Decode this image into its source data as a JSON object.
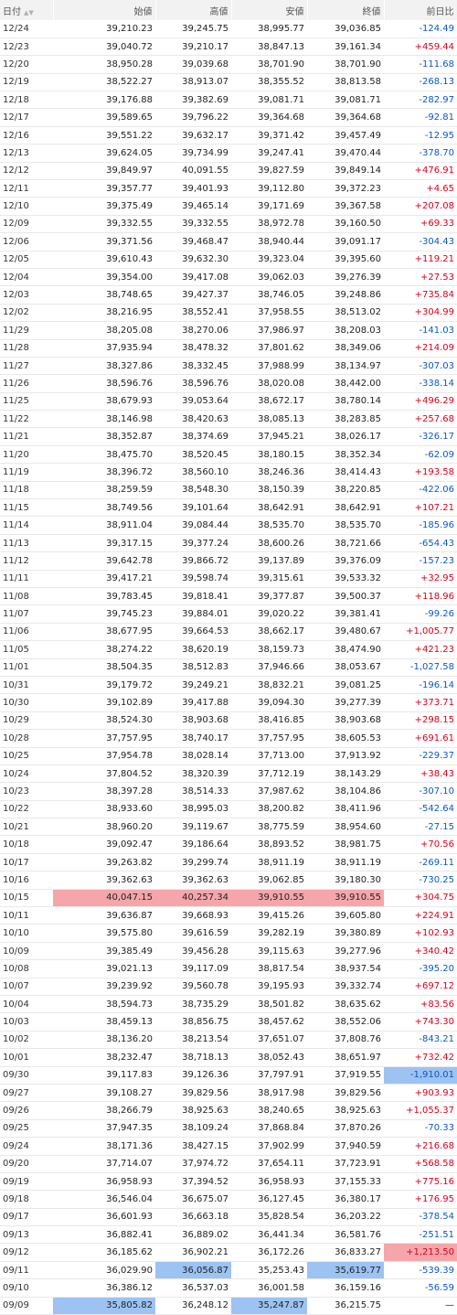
{
  "columns": {
    "date": "日付",
    "open": "始値",
    "high": "高値",
    "low": "安値",
    "close": "終値",
    "change": "前日比"
  },
  "sort_arrows": "▲▼",
  "colors": {
    "positive": "#d8001b",
    "negative": "#0a58c2",
    "high_highlight": "#f5a6ab",
    "low_highlight": "#9cc3f2"
  },
  "rows": [
    {
      "date": "12/24",
      "open": "39,210.23",
      "high": "39,245.75",
      "low": "38,995.77",
      "close": "39,036.85",
      "change": "-124.49"
    },
    {
      "date": "12/23",
      "open": "39,040.72",
      "high": "39,210.17",
      "low": "38,847.13",
      "close": "39,161.34",
      "change": "+459.44"
    },
    {
      "date": "12/20",
      "open": "38,950.28",
      "high": "39,039.68",
      "low": "38,701.90",
      "close": "38,701.90",
      "change": "-111.68"
    },
    {
      "date": "12/19",
      "open": "38,522.27",
      "high": "38,913.07",
      "low": "38,355.52",
      "close": "38,813.58",
      "change": "-268.13"
    },
    {
      "date": "12/18",
      "open": "39,176.88",
      "high": "39,382.69",
      "low": "39,081.71",
      "close": "39,081.71",
      "change": "-282.97"
    },
    {
      "date": "12/17",
      "open": "39,589.65",
      "high": "39,796.22",
      "low": "39,364.68",
      "close": "39,364.68",
      "change": "-92.81"
    },
    {
      "date": "12/16",
      "open": "39,551.22",
      "high": "39,632.17",
      "low": "39,371.42",
      "close": "39,457.49",
      "change": "-12.95"
    },
    {
      "date": "12/13",
      "open": "39,624.05",
      "high": "39,734.99",
      "low": "39,247.41",
      "close": "39,470.44",
      "change": "-378.70"
    },
    {
      "date": "12/12",
      "open": "39,849.97",
      "high": "40,091.55",
      "low": "39,827.59",
      "close": "39,849.14",
      "change": "+476.91"
    },
    {
      "date": "12/11",
      "open": "39,357.77",
      "high": "39,401.93",
      "low": "39,112.80",
      "close": "39,372.23",
      "change": "+4.65"
    },
    {
      "date": "12/10",
      "open": "39,375.49",
      "high": "39,465.14",
      "low": "39,171.69",
      "close": "39,367.58",
      "change": "+207.08"
    },
    {
      "date": "12/09",
      "open": "39,332.55",
      "high": "39,332.55",
      "low": "38,972.78",
      "close": "39,160.50",
      "change": "+69.33"
    },
    {
      "date": "12/06",
      "open": "39,371.56",
      "high": "39,468.47",
      "low": "38,940.44",
      "close": "39,091.17",
      "change": "-304.43"
    },
    {
      "date": "12/05",
      "open": "39,610.43",
      "high": "39,632.30",
      "low": "39,323.04",
      "close": "39,395.60",
      "change": "+119.21"
    },
    {
      "date": "12/04",
      "open": "39,354.00",
      "high": "39,417.08",
      "low": "39,062.03",
      "close": "39,276.39",
      "change": "+27.53"
    },
    {
      "date": "12/03",
      "open": "38,748.65",
      "high": "39,427.37",
      "low": "38,746.05",
      "close": "39,248.86",
      "change": "+735.84"
    },
    {
      "date": "12/02",
      "open": "38,216.95",
      "high": "38,552.41",
      "low": "37,958.55",
      "close": "38,513.02",
      "change": "+304.99"
    },
    {
      "date": "11/29",
      "open": "38,205.08",
      "high": "38,270.06",
      "low": "37,986.97",
      "close": "38,208.03",
      "change": "-141.03"
    },
    {
      "date": "11/28",
      "open": "37,935.94",
      "high": "38,478.32",
      "low": "37,801.62",
      "close": "38,349.06",
      "change": "+214.09"
    },
    {
      "date": "11/27",
      "open": "38,327.86",
      "high": "38,332.45",
      "low": "37,988.99",
      "close": "38,134.97",
      "change": "-307.03"
    },
    {
      "date": "11/26",
      "open": "38,596.76",
      "high": "38,596.76",
      "low": "38,020.08",
      "close": "38,442.00",
      "change": "-338.14"
    },
    {
      "date": "11/25",
      "open": "38,679.93",
      "high": "39,053.64",
      "low": "38,672.17",
      "close": "38,780.14",
      "change": "+496.29"
    },
    {
      "date": "11/22",
      "open": "38,146.98",
      "high": "38,420.63",
      "low": "38,085.13",
      "close": "38,283.85",
      "change": "+257.68"
    },
    {
      "date": "11/21",
      "open": "38,352.87",
      "high": "38,374.69",
      "low": "37,945.21",
      "close": "38,026.17",
      "change": "-326.17"
    },
    {
      "date": "11/20",
      "open": "38,475.70",
      "high": "38,520.45",
      "low": "38,180.15",
      "close": "38,352.34",
      "change": "-62.09"
    },
    {
      "date": "11/19",
      "open": "38,396.72",
      "high": "38,560.10",
      "low": "38,246.36",
      "close": "38,414.43",
      "change": "+193.58"
    },
    {
      "date": "11/18",
      "open": "38,259.59",
      "high": "38,548.30",
      "low": "38,150.39",
      "close": "38,220.85",
      "change": "-422.06"
    },
    {
      "date": "11/15",
      "open": "38,749.56",
      "high": "39,101.64",
      "low": "38,642.91",
      "close": "38,642.91",
      "change": "+107.21"
    },
    {
      "date": "11/14",
      "open": "38,911.04",
      "high": "39,084.44",
      "low": "38,535.70",
      "close": "38,535.70",
      "change": "-185.96"
    },
    {
      "date": "11/13",
      "open": "39,317.15",
      "high": "39,377.24",
      "low": "38,600.26",
      "close": "38,721.66",
      "change": "-654.43"
    },
    {
      "date": "11/12",
      "open": "39,642.78",
      "high": "39,866.72",
      "low": "39,137.89",
      "close": "39,376.09",
      "change": "-157.23"
    },
    {
      "date": "11/11",
      "open": "39,417.21",
      "high": "39,598.74",
      "low": "39,315.61",
      "close": "39,533.32",
      "change": "+32.95"
    },
    {
      "date": "11/08",
      "open": "39,783.45",
      "high": "39,818.41",
      "low": "39,377.87",
      "close": "39,500.37",
      "change": "+118.96"
    },
    {
      "date": "11/07",
      "open": "39,745.23",
      "high": "39,884.01",
      "low": "39,020.22",
      "close": "39,381.41",
      "change": "-99.26"
    },
    {
      "date": "11/06",
      "open": "38,677.95",
      "high": "39,664.53",
      "low": "38,662.17",
      "close": "39,480.67",
      "change": "+1,005.77"
    },
    {
      "date": "11/05",
      "open": "38,274.22",
      "high": "38,620.19",
      "low": "38,159.73",
      "close": "38,474.90",
      "change": "+421.23"
    },
    {
      "date": "11/01",
      "open": "38,504.35",
      "high": "38,512.83",
      "low": "37,946.66",
      "close": "38,053.67",
      "change": "-1,027.58"
    },
    {
      "date": "10/31",
      "open": "39,179.72",
      "high": "39,249.21",
      "low": "38,832.21",
      "close": "39,081.25",
      "change": "-196.14"
    },
    {
      "date": "10/30",
      "open": "39,102.89",
      "high": "39,417.88",
      "low": "39,094.30",
      "close": "39,277.39",
      "change": "+373.71"
    },
    {
      "date": "10/29",
      "open": "38,524.30",
      "high": "38,903.68",
      "low": "38,416.85",
      "close": "38,903.68",
      "change": "+298.15"
    },
    {
      "date": "10/28",
      "open": "37,757.95",
      "high": "38,740.17",
      "low": "37,757.95",
      "close": "38,605.53",
      "change": "+691.61"
    },
    {
      "date": "10/25",
      "open": "37,954.78",
      "high": "38,028.14",
      "low": "37,713.00",
      "close": "37,913.92",
      "change": "-229.37"
    },
    {
      "date": "10/24",
      "open": "37,804.52",
      "high": "38,320.39",
      "low": "37,712.19",
      "close": "38,143.29",
      "change": "+38.43"
    },
    {
      "date": "10/23",
      "open": "38,397.28",
      "high": "38,514.33",
      "low": "37,987.62",
      "close": "38,104.86",
      "change": "-307.10"
    },
    {
      "date": "10/22",
      "open": "38,933.60",
      "high": "38,995.03",
      "low": "38,200.82",
      "close": "38,411.96",
      "change": "-542.64"
    },
    {
      "date": "10/21",
      "open": "38,960.20",
      "high": "39,119.67",
      "low": "38,775.59",
      "close": "38,954.60",
      "change": "-27.15"
    },
    {
      "date": "10/18",
      "open": "39,092.47",
      "high": "39,186.64",
      "low": "38,893.52",
      "close": "38,981.75",
      "change": "+70.56"
    },
    {
      "date": "10/17",
      "open": "39,263.82",
      "high": "39,299.74",
      "low": "38,911.19",
      "close": "38,911.19",
      "change": "-269.11"
    },
    {
      "date": "10/16",
      "open": "39,362.63",
      "high": "39,362.63",
      "low": "39,062.85",
      "close": "39,180.30",
      "change": "-730.25"
    },
    {
      "date": "10/15",
      "open": "40,047.15",
      "high": "40,257.34",
      "low": "39,910.55",
      "close": "39,910.55",
      "change": "+304.75",
      "highlight": "red"
    },
    {
      "date": "10/11",
      "open": "39,636.87",
      "high": "39,668.93",
      "low": "39,415.26",
      "close": "39,605.80",
      "change": "+224.91"
    },
    {
      "date": "10/10",
      "open": "39,575.80",
      "high": "39,616.59",
      "low": "39,282.19",
      "close": "39,380.89",
      "change": "+102.93"
    },
    {
      "date": "10/09",
      "open": "39,385.49",
      "high": "39,456.28",
      "low": "39,115.63",
      "close": "39,277.96",
      "change": "+340.42"
    },
    {
      "date": "10/08",
      "open": "39,021.13",
      "high": "39,117.09",
      "low": "38,817.54",
      "close": "38,937.54",
      "change": "-395.20"
    },
    {
      "date": "10/07",
      "open": "39,239.92",
      "high": "39,560.78",
      "low": "39,195.93",
      "close": "39,332.74",
      "change": "+697.12"
    },
    {
      "date": "10/04",
      "open": "38,594.73",
      "high": "38,735.29",
      "low": "38,501.82",
      "close": "38,635.62",
      "change": "+83.56"
    },
    {
      "date": "10/03",
      "open": "38,459.13",
      "high": "38,856.75",
      "low": "38,457.62",
      "close": "38,552.06",
      "change": "+743.30"
    },
    {
      "date": "10/02",
      "open": "38,136.20",
      "high": "38,213.54",
      "low": "37,651.07",
      "close": "37,808.76",
      "change": "-843.21"
    },
    {
      "date": "10/01",
      "open": "38,232.47",
      "high": "38,718.13",
      "low": "38,052.43",
      "close": "38,651.97",
      "change": "+732.42"
    },
    {
      "date": "09/30",
      "open": "39,117.83",
      "high": "39,126.36",
      "low": "37,797.91",
      "close": "37,919.55",
      "change": "-1,910.01",
      "change_highlight": "blue"
    },
    {
      "date": "09/27",
      "open": "39,108.27",
      "high": "39,829.56",
      "low": "38,917.98",
      "close": "39,829.56",
      "change": "+903.93"
    },
    {
      "date": "09/26",
      "open": "38,266.79",
      "high": "38,925.63",
      "low": "38,240.65",
      "close": "38,925.63",
      "change": "+1,055.37"
    },
    {
      "date": "09/25",
      "open": "37,947.35",
      "high": "38,109.24",
      "low": "37,868.84",
      "close": "37,870.26",
      "change": "-70.33"
    },
    {
      "date": "09/24",
      "open": "38,171.36",
      "high": "38,427.15",
      "low": "37,902.99",
      "close": "37,940.59",
      "change": "+216.68"
    },
    {
      "date": "09/20",
      "open": "37,714.07",
      "high": "37,974.72",
      "low": "37,654.11",
      "close": "37,723.91",
      "change": "+568.58"
    },
    {
      "date": "09/19",
      "open": "36,958.93",
      "high": "37,394.52",
      "low": "36,958.93",
      "close": "37,155.33",
      "change": "+775.16"
    },
    {
      "date": "09/18",
      "open": "36,546.04",
      "high": "36,675.07",
      "low": "36,127.45",
      "close": "36,380.17",
      "change": "+176.95"
    },
    {
      "date": "09/17",
      "open": "36,601.93",
      "high": "36,663.18",
      "low": "35,828.54",
      "close": "36,203.22",
      "change": "-378.54"
    },
    {
      "date": "09/13",
      "open": "36,882.41",
      "high": "36,889.02",
      "low": "36,441.34",
      "close": "36,581.76",
      "change": "-251.51"
    },
    {
      "date": "09/12",
      "open": "36,185.62",
      "high": "36,902.21",
      "low": "36,172.26",
      "close": "36,833.27",
      "change": "+1,213.50",
      "change_highlight": "red"
    },
    {
      "date": "09/11",
      "open": "36,029.90",
      "high": "36,056.87",
      "low": "35,253.43",
      "close": "35,619.77",
      "change": "-539.39",
      "high_highlight": "blue",
      "close_highlight": "blue"
    },
    {
      "date": "09/10",
      "open": "36,386.12",
      "high": "36,537.03",
      "low": "36,001.58",
      "close": "36,159.16",
      "change": "-56.59"
    },
    {
      "date": "09/09",
      "open": "35,805.82",
      "high": "36,248.12",
      "low": "35,247.87",
      "close": "36,215.75",
      "change": "—",
      "open_highlight": "blue",
      "low_highlight": "blue"
    }
  ]
}
